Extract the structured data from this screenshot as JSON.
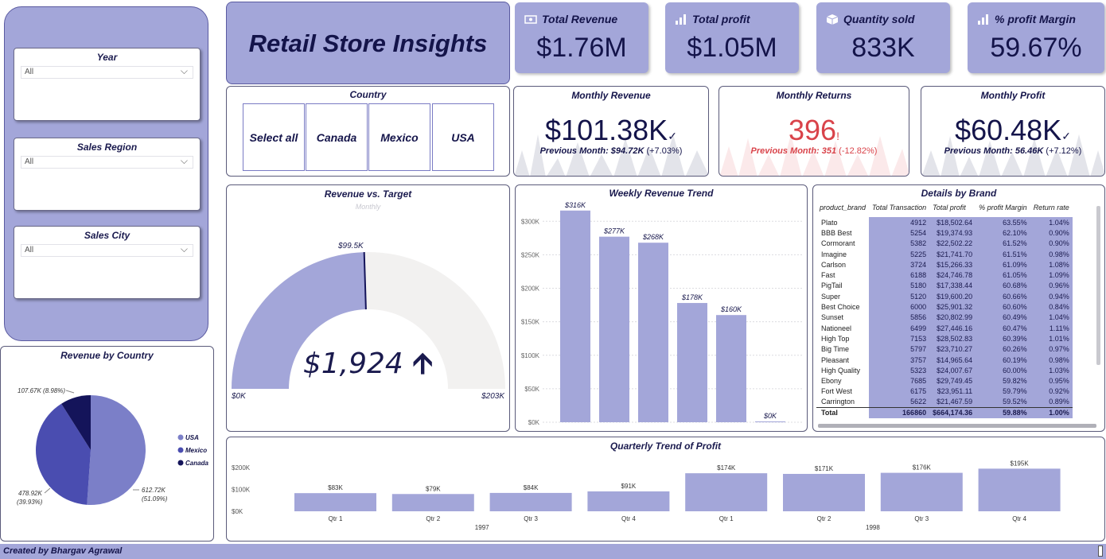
{
  "slicers": {
    "year": {
      "title": "Year",
      "value": "All"
    },
    "region": {
      "title": "Sales Region",
      "value": "All"
    },
    "city": {
      "title": "Sales City",
      "value": "All"
    }
  },
  "header": {
    "title": "Retail Store Insights"
  },
  "kpis": [
    {
      "label": "Total Revenue",
      "value": "$1.76M",
      "icon": "money-icon"
    },
    {
      "label": "Total profit",
      "value": "$1.05M",
      "icon": "bar-chart-icon"
    },
    {
      "label": "Quantity sold",
      "value": "833K",
      "icon": "box-icon"
    },
    {
      "label": "% profit Margin",
      "value": "59.67%",
      "icon": "bar-chart-icon"
    }
  ],
  "country": {
    "title": "Country",
    "options": [
      "Select all",
      "Canada",
      "Mexico",
      "USA"
    ]
  },
  "monthly": {
    "revenue": {
      "title": "Monthly Revenue",
      "value": "$101.38K",
      "mark": "✓",
      "prev": "Previous Month: $94.72K",
      "change": "(+7.03%)"
    },
    "returns": {
      "title": "Monthly Returns",
      "value": "396",
      "mark": "!",
      "prev": "Previous Month: 351",
      "change": "(-12.82%)"
    },
    "profit": {
      "title": "Monthly Profit",
      "value": "$60.48K",
      "mark": "✓",
      "prev": "Previous Month: 56.46K",
      "change": "(+7.12%)"
    }
  },
  "gauge": {
    "title": "Revenue vs. Target",
    "subtitle": "Monthly",
    "value": "$1,924",
    "target_label": "$99.5K",
    "min_label": "$0K",
    "max_label": "$203K",
    "min": 0,
    "max": 203,
    "target": 99.5
  },
  "weekly": {
    "title": "Weekly Revenue Trend"
  },
  "brand": {
    "title": "Details by Brand",
    "columns": [
      "product_brand",
      "Total Transaction",
      "Total profit",
      "% profit Margin",
      "Return rate"
    ],
    "rows": [
      [
        "Plato",
        "4912",
        "$18,502.64",
        "63.55%",
        "1.04%"
      ],
      [
        "BBB Best",
        "5254",
        "$19,374.93",
        "62.10%",
        "0.90%"
      ],
      [
        "Cormorant",
        "5382",
        "$22,502.22",
        "61.52%",
        "0.90%"
      ],
      [
        "Imagine",
        "5225",
        "$21,741.70",
        "61.51%",
        "0.98%"
      ],
      [
        "Carlson",
        "3724",
        "$15,266.33",
        "61.09%",
        "1.08%"
      ],
      [
        "Fast",
        "6188",
        "$24,746.78",
        "61.05%",
        "1.09%"
      ],
      [
        "PigTail",
        "5180",
        "$17,338.44",
        "60.68%",
        "0.96%"
      ],
      [
        "Super",
        "5120",
        "$19,600.20",
        "60.66%",
        "0.94%"
      ],
      [
        "Best Choice",
        "6000",
        "$25,901.32",
        "60.60%",
        "0.84%"
      ],
      [
        "Sunset",
        "5856",
        "$20,802.99",
        "60.49%",
        "1.04%"
      ],
      [
        "Nationeel",
        "6499",
        "$27,446.16",
        "60.47%",
        "1.11%"
      ],
      [
        "High Top",
        "7153",
        "$28,502.83",
        "60.39%",
        "1.01%"
      ],
      [
        "Big Time",
        "5797",
        "$23,710.27",
        "60.26%",
        "0.97%"
      ],
      [
        "Pleasant",
        "3757",
        "$14,965.64",
        "60.19%",
        "0.98%"
      ],
      [
        "High Quality",
        "5323",
        "$24,007.67",
        "60.00%",
        "1.03%"
      ],
      [
        "Ebony",
        "7685",
        "$29,749.45",
        "59.82%",
        "0.95%"
      ],
      [
        "Fort West",
        "6175",
        "$23,951.11",
        "59.79%",
        "0.92%"
      ],
      [
        "Carrington",
        "5622",
        "$21,467.59",
        "59.52%",
        "0.89%"
      ]
    ],
    "total": [
      "Total",
      "166860",
      "$664,174.36",
      "59.88%",
      "1.00%"
    ]
  },
  "pie": {
    "title": "Revenue by Country"
  },
  "quarterly": {
    "title": "Quarterly Trend of Profit"
  },
  "footer": {
    "credit": "Created by Bhargav Agrawal"
  },
  "colors": {
    "accent": "#a3a6d9",
    "dark": "#14144a",
    "returns": "#d9434a"
  },
  "chart_data": [
    {
      "type": "bar",
      "title": "Weekly Revenue Trend",
      "categories": [
        "",
        "",
        "",
        "",
        "",
        ""
      ],
      "values": [
        316,
        277,
        268,
        178,
        160,
        0
      ],
      "value_labels": [
        "$316K",
        "$277K",
        "$268K",
        "$178K",
        "$160K",
        "$0K"
      ],
      "yticks": [
        "$0K",
        "$50K",
        "$100K",
        "$150K",
        "$200K",
        "$250K",
        "$300K"
      ],
      "ylim": [
        0,
        330
      ],
      "grid": true
    },
    {
      "type": "pie",
      "title": "Revenue by Country",
      "slices": [
        {
          "name": "USA",
          "value": 612.72,
          "label": "612.72K",
          "pct": "(51.09%)",
          "color": "#7b7fc8"
        },
        {
          "name": "Mexico",
          "value": 478.92,
          "label": "478.92K",
          "pct": "(39.93%)",
          "color": "#4a4db0"
        },
        {
          "name": "Canada",
          "value": 107.67,
          "label": "107.67K (8.98%)",
          "pct": "",
          "color": "#14145a"
        }
      ],
      "legend": "right"
    },
    {
      "type": "bar",
      "title": "Quarterly Trend of Profit",
      "categories": [
        "Qtr 1",
        "Qtr 2",
        "Qtr 3",
        "Qtr 4",
        "Qtr 1",
        "Qtr 2",
        "Qtr 3",
        "Qtr 4"
      ],
      "groups": [
        "1997",
        "1998"
      ],
      "values": [
        83,
        79,
        84,
        91,
        174,
        171,
        176,
        195
      ],
      "value_labels": [
        "$83K",
        "$79K",
        "$84K",
        "$91K",
        "$174K",
        "$171K",
        "$176K",
        "$195K"
      ],
      "yticks": [
        "$0K",
        "$100K",
        "$200K"
      ],
      "ylim": [
        0,
        200
      ]
    }
  ]
}
